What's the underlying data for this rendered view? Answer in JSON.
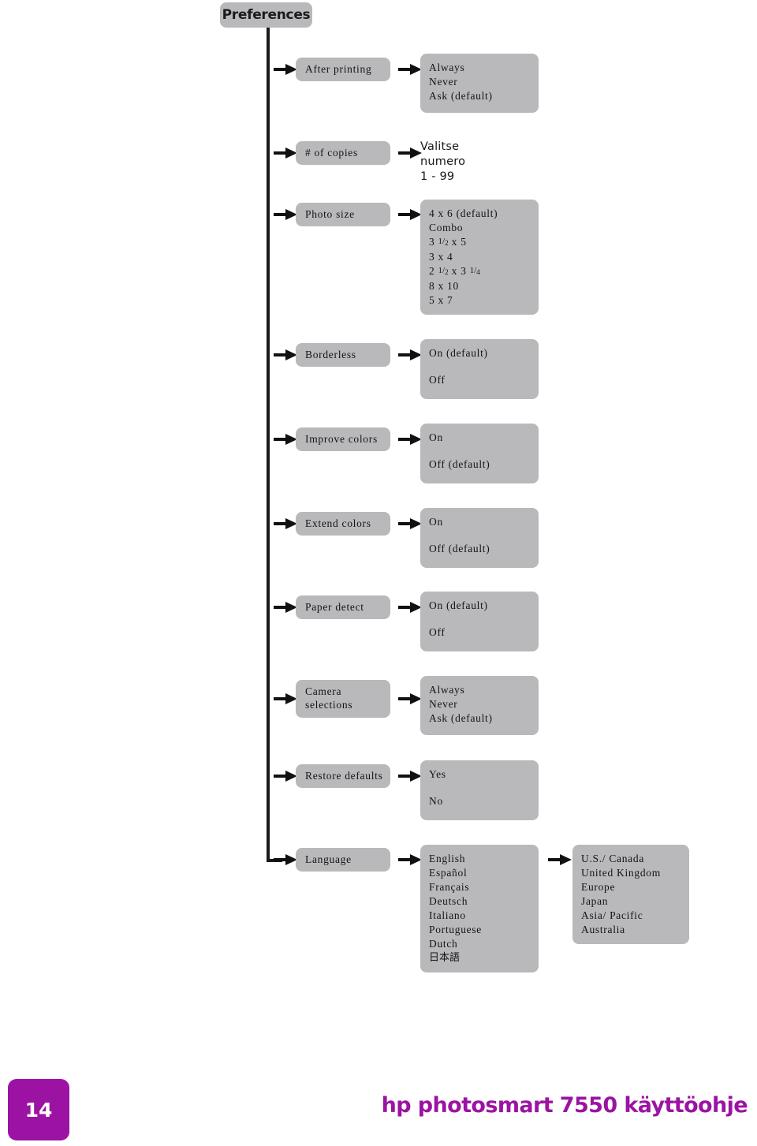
{
  "document": {
    "root_label": "Preferences",
    "page_number": "14",
    "footer_title": "hp photosmart 7550 käyttöohje",
    "colors": {
      "chip_gray": "#b9b9bc",
      "arrow_black": "#111111",
      "brand_purple": "#9c13a3",
      "text": "#141414"
    }
  },
  "menu": {
    "rows": [
      {
        "label": "After printing",
        "values": [
          "Always",
          "Never",
          "Ask (default)"
        ],
        "spaced": false,
        "boxed": true
      },
      {
        "label": "# of copies",
        "values": [
          "Valitse numero",
          "1 - 99"
        ],
        "spaced": false,
        "boxed": false
      },
      {
        "label": "Photo size",
        "values": [
          "4 x 6 (default)",
          "Combo",
          "3 1/2 x 5",
          "3 x 4",
          "2 1/2 x 3 1/4",
          "8 x 10",
          "5 x 7"
        ],
        "spaced": false,
        "boxed": true
      },
      {
        "label": "Borderless",
        "values": [
          "On (default)",
          "Off"
        ],
        "spaced": true,
        "boxed": true
      },
      {
        "label": "Improve colors",
        "values": [
          "On",
          "Off (default)"
        ],
        "spaced": true,
        "boxed": true
      },
      {
        "label": "Extend colors",
        "values": [
          "On",
          "Off (default)"
        ],
        "spaced": true,
        "boxed": true
      },
      {
        "label": "Paper detect",
        "values": [
          "On (default)",
          "Off"
        ],
        "spaced": true,
        "boxed": true
      },
      {
        "label": "Camera selections",
        "values": [
          "Always",
          "Never",
          "Ask (default)"
        ],
        "spaced": false,
        "boxed": true
      },
      {
        "label": "Restore defaults",
        "values": [
          "Yes",
          "No"
        ],
        "spaced": true,
        "boxed": true
      },
      {
        "label": "Language",
        "values": [
          "English",
          "Español",
          "Français",
          "Deutsch",
          "Italiano",
          "Portuguese",
          "Dutch",
          "日本語"
        ],
        "spaced": false,
        "boxed": true,
        "third_column": [
          "U.S./ Canada",
          "United Kingdom",
          "Europe",
          "Japan",
          "Asia/ Pacific",
          "Australia"
        ]
      }
    ]
  }
}
